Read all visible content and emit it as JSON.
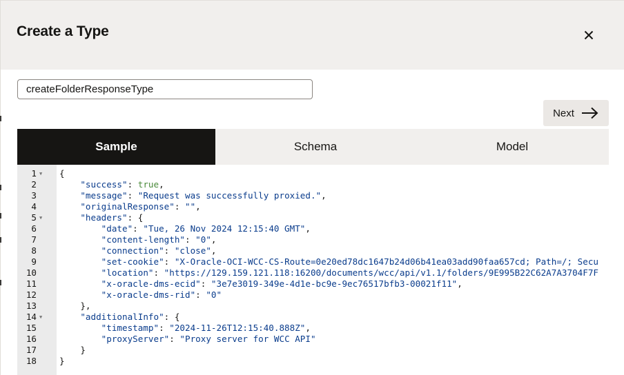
{
  "dialog": {
    "title": "Create a Type",
    "close_icon": "close-icon",
    "name_field_value": "createFolderResponseType",
    "next_label": "Next",
    "next_icon": "arrow-right-icon"
  },
  "tabs": [
    {
      "label": "Sample",
      "active": true
    },
    {
      "label": "Schema",
      "active": false
    },
    {
      "label": "Model",
      "active": false
    }
  ],
  "colors": {
    "header_bg": "#f1efed",
    "active_tab_bg": "#161513",
    "gutter_bg": "#ebebeb",
    "key_color": "#0a3c8c",
    "bool_color": "#4a8a3a"
  },
  "editor": {
    "lines": [
      {
        "n": "1",
        "fold": true,
        "parts": [
          [
            "p",
            "{"
          ]
        ]
      },
      {
        "n": "2",
        "fold": false,
        "parts": [
          [
            "p",
            "    "
          ],
          [
            "k",
            "\"success\""
          ],
          [
            "p",
            ": "
          ],
          [
            "b",
            "true"
          ],
          [
            "p",
            ","
          ]
        ]
      },
      {
        "n": "3",
        "fold": false,
        "parts": [
          [
            "p",
            "    "
          ],
          [
            "k",
            "\"message\""
          ],
          [
            "p",
            ": "
          ],
          [
            "s",
            "\"Request was successfully proxied.\""
          ],
          [
            "p",
            ","
          ]
        ]
      },
      {
        "n": "4",
        "fold": false,
        "parts": [
          [
            "p",
            "    "
          ],
          [
            "k",
            "\"originalResponse\""
          ],
          [
            "p",
            ": "
          ],
          [
            "s",
            "\"\""
          ],
          [
            "p",
            ","
          ]
        ]
      },
      {
        "n": "5",
        "fold": true,
        "parts": [
          [
            "p",
            "    "
          ],
          [
            "k",
            "\"headers\""
          ],
          [
            "p",
            ": {"
          ]
        ]
      },
      {
        "n": "6",
        "fold": false,
        "parts": [
          [
            "p",
            "        "
          ],
          [
            "k",
            "\"date\""
          ],
          [
            "p",
            ": "
          ],
          [
            "s",
            "\"Tue, 26 Nov 2024 12:15:40 GMT\""
          ],
          [
            "p",
            ","
          ]
        ]
      },
      {
        "n": "7",
        "fold": false,
        "parts": [
          [
            "p",
            "        "
          ],
          [
            "k",
            "\"content-length\""
          ],
          [
            "p",
            ": "
          ],
          [
            "s",
            "\"0\""
          ],
          [
            "p",
            ","
          ]
        ]
      },
      {
        "n": "8",
        "fold": false,
        "parts": [
          [
            "p",
            "        "
          ],
          [
            "k",
            "\"connection\""
          ],
          [
            "p",
            ": "
          ],
          [
            "s",
            "\"close\""
          ],
          [
            "p",
            ","
          ]
        ]
      },
      {
        "n": "9",
        "fold": false,
        "parts": [
          [
            "p",
            "        "
          ],
          [
            "k",
            "\"set-cookie\""
          ],
          [
            "p",
            ": "
          ],
          [
            "s",
            "\"X-Oracle-OCI-WCC-CS-Route=0e20ed78dc1647b24d06b41ea03add90faa657cd; Path=/; Secu"
          ]
        ]
      },
      {
        "n": "10",
        "fold": false,
        "parts": [
          [
            "p",
            "        "
          ],
          [
            "k",
            "\"location\""
          ],
          [
            "p",
            ": "
          ],
          [
            "s",
            "\"https://129.159.121.118:16200/documents/wcc/api/v1.1/folders/9E995B22C62A7A3704F7F"
          ]
        ]
      },
      {
        "n": "11",
        "fold": false,
        "parts": [
          [
            "p",
            "        "
          ],
          [
            "k",
            "\"x-oracle-dms-ecid\""
          ],
          [
            "p",
            ": "
          ],
          [
            "s",
            "\"3e7e3019-349e-4d1e-bc9e-9ec76517bfb3-00021f11\""
          ],
          [
            "p",
            ","
          ]
        ]
      },
      {
        "n": "12",
        "fold": false,
        "parts": [
          [
            "p",
            "        "
          ],
          [
            "k",
            "\"x-oracle-dms-rid\""
          ],
          [
            "p",
            ": "
          ],
          [
            "s",
            "\"0\""
          ]
        ]
      },
      {
        "n": "13",
        "fold": false,
        "parts": [
          [
            "p",
            "    },"
          ]
        ]
      },
      {
        "n": "14",
        "fold": true,
        "parts": [
          [
            "p",
            "    "
          ],
          [
            "k",
            "\"additionalInfo\""
          ],
          [
            "p",
            ": {"
          ]
        ]
      },
      {
        "n": "15",
        "fold": false,
        "parts": [
          [
            "p",
            "        "
          ],
          [
            "k",
            "\"timestamp\""
          ],
          [
            "p",
            ": "
          ],
          [
            "s",
            "\"2024-11-26T12:15:40.888Z\""
          ],
          [
            "p",
            ","
          ]
        ]
      },
      {
        "n": "16",
        "fold": false,
        "parts": [
          [
            "p",
            "        "
          ],
          [
            "k",
            "\"proxyServer\""
          ],
          [
            "p",
            ": "
          ],
          [
            "s",
            "\"Proxy server for WCC API\""
          ]
        ]
      },
      {
        "n": "17",
        "fold": false,
        "parts": [
          [
            "p",
            "    }"
          ]
        ]
      },
      {
        "n": "18",
        "fold": false,
        "parts": [
          [
            "p",
            "}"
          ]
        ]
      }
    ]
  }
}
